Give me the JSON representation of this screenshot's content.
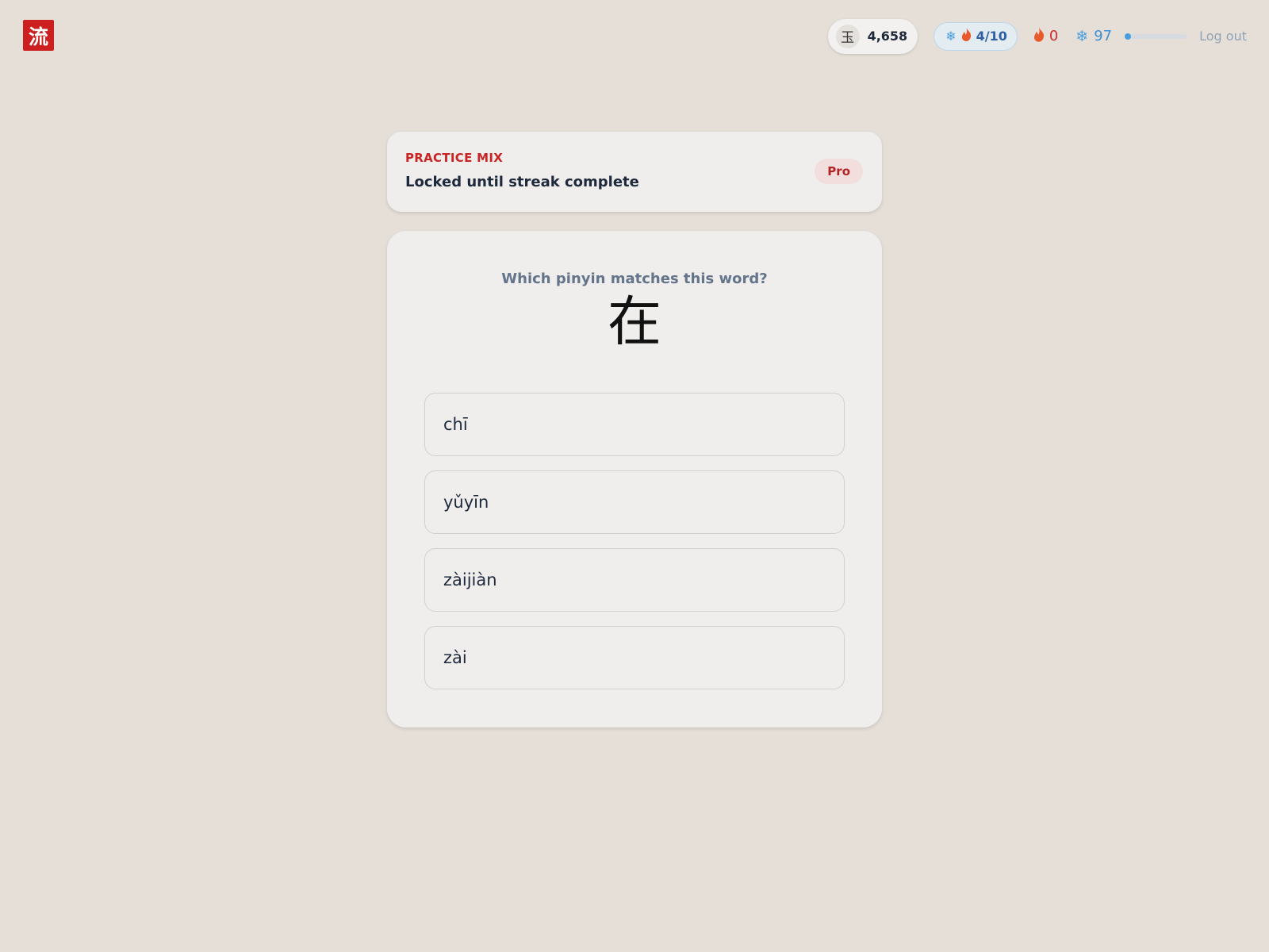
{
  "header": {
    "logo_char": "流",
    "jade": {
      "icon_char": "玉",
      "count": "4,658"
    },
    "streak": {
      "count": "4/10"
    },
    "fire_stat": {
      "value": "0"
    },
    "snow_stat": {
      "value": "97",
      "progress_fraction": 0.1
    },
    "logout_label": "Log out"
  },
  "practice": {
    "kicker": "PRACTICE MIX",
    "title": "Locked until streak complete",
    "badge": "Pro"
  },
  "quiz": {
    "question": "Which pinyin matches this word?",
    "hanzi": "在",
    "options": [
      "chī",
      "yǔyīn",
      "zàijiàn",
      "zài"
    ]
  },
  "icons": {
    "snowflake": "snowflake-icon",
    "fire": "fire-icon",
    "jade": "jade-icon"
  },
  "colors": {
    "brand_red": "#cc1f1f",
    "ice_blue": "#4a9ee0",
    "background": "#e5dfd7"
  }
}
